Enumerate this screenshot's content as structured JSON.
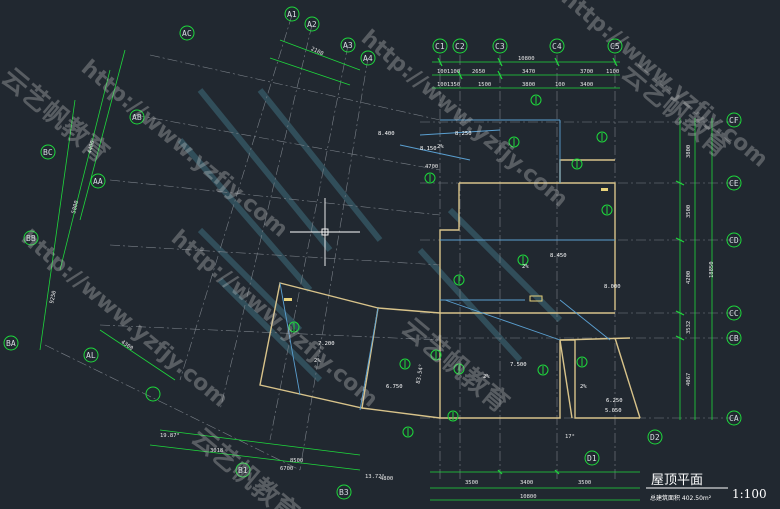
{
  "drawing": {
    "title": "屋顶平面",
    "scale": "1:100",
    "area_label": "总建筑面积 402.50m²"
  },
  "grids_top": [
    "C1",
    "C2",
    "C3",
    "C4",
    "C5"
  ],
  "grids_right": [
    "CF",
    "CE",
    "CD",
    "CC",
    "CB",
    "CA"
  ],
  "grids_radial": [
    "A1",
    "A2",
    "A3",
    "A4"
  ],
  "grids_left": [
    "AC",
    "AB",
    "AA",
    "BC",
    "BB",
    "BA",
    "AL"
  ],
  "grids_bottom": [
    "B1",
    "B3",
    "D1",
    "D2"
  ],
  "dims_top_total": "10800",
  "dims_top_row1": [
    "1001100",
    "2650",
    "3470",
    "3700",
    "1100"
  ],
  "dims_top_row2": [
    "1001350",
    "1500",
    "3800",
    "100",
    "3400",
    "100"
  ],
  "dims_right": [
    "3800",
    "3500",
    "4200",
    "3532",
    "4067",
    "1200"
  ],
  "dims_right_total": "18850",
  "dims_bottom": [
    "3500",
    "3400",
    "3500",
    "100"
  ],
  "dims_bottom_total": "10800",
  "dims_left": [
    "4400",
    "5800",
    "9250",
    "4300",
    "3500"
  ],
  "dims_misc": [
    "4700",
    "2100",
    "8500",
    "6700",
    "3018",
    "4800",
    "4500",
    "1900",
    "1900"
  ],
  "angles": [
    "19.87°",
    "13.72°",
    "83.54°",
    "17°"
  ],
  "elevations": [
    "8.400",
    "8.250",
    "8.150",
    "8.450",
    "8.000",
    "7.200",
    "7.500",
    "6.750",
    "6.250",
    "7.500",
    "7.200",
    "5.050"
  ],
  "slopes": [
    "2%",
    "2%",
    "2%",
    "2%",
    "2%"
  ],
  "watermarks": [
    "http://www.yzfjy.com",
    "云艺帆教育"
  ]
}
